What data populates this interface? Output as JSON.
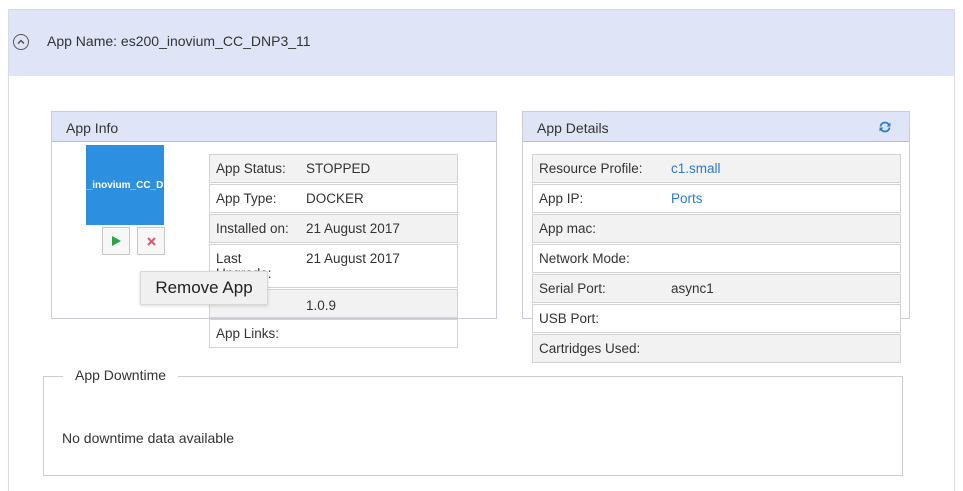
{
  "header": {
    "app_name": "App Name: es200_inovium_CC_DNP3_11"
  },
  "app_info": {
    "title": "App Info",
    "tile_label": "_inovium_CC_D",
    "tooltip": "Remove App",
    "rows": {
      "status": {
        "label": "App Status:",
        "value": "STOPPED"
      },
      "type": {
        "label": "App Type:",
        "value": "DOCKER"
      },
      "installed": {
        "label": "Installed on:",
        "value": "21 August 2017"
      },
      "upgrade": {
        "label": "Last Upgrade:",
        "value": "21 August 2017"
      },
      "version": {
        "value": "1.0.9"
      },
      "links": {
        "label": "App Links:",
        "value": ""
      }
    }
  },
  "app_details": {
    "title": "App Details",
    "rows": {
      "profile": {
        "label": "Resource Profile:",
        "value": "c1.small"
      },
      "ip": {
        "label": "App IP:",
        "value": "Ports"
      },
      "mac": {
        "label": "App mac:",
        "value": ""
      },
      "network": {
        "label": "Network Mode:",
        "value": ""
      },
      "serial": {
        "label": "Serial Port:",
        "value": "async1"
      },
      "usb": {
        "label": "USB Port:",
        "value": ""
      },
      "cartridges": {
        "label": "Cartridges Used:",
        "value": ""
      }
    }
  },
  "downtime": {
    "title": "App Downtime",
    "message": "No downtime data available"
  },
  "colors": {
    "header_bg": "#dfe5f6",
    "tile_bg": "#2c8fe0",
    "link": "#2a7bd0",
    "start_icon": "#27a844",
    "remove_icon": "#e05a6a"
  }
}
